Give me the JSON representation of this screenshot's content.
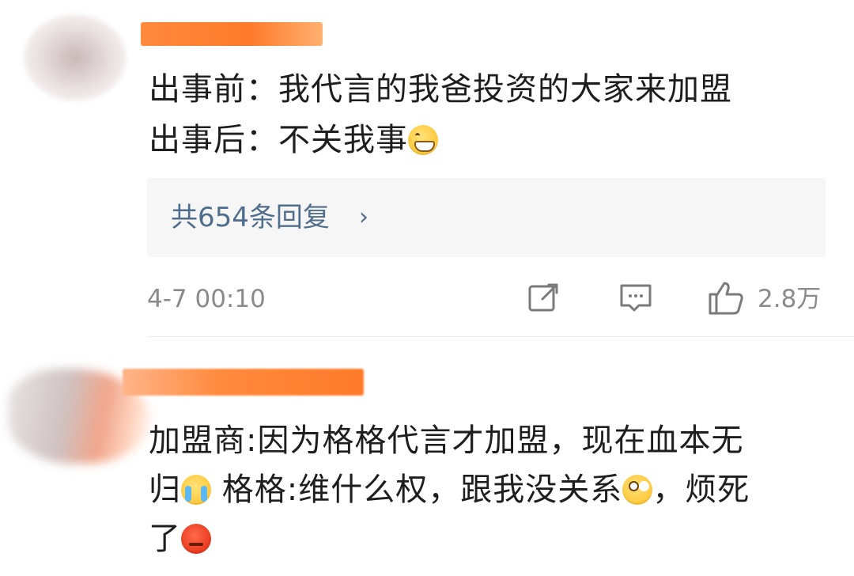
{
  "comments": [
    {
      "lines": [
        "出事前：我代言的我爸投资的大家来加盟",
        "出事后：不关我事"
      ],
      "emojis": [
        "grin"
      ],
      "replies_label": "共654条回复",
      "replies_chevron": "›",
      "timestamp": "4-7 00:10",
      "like_count": "2.8万"
    },
    {
      "lines": [
        "加盟商:因为格格代言才加盟，现在血本无",
        "归",
        "格格:维什么权，跟我没关系",
        "，烦死",
        "了"
      ],
      "emojis": [
        "cry",
        "eyeroll",
        "angry"
      ]
    }
  ],
  "icons": {
    "share": "share-icon",
    "reply": "comment-icon",
    "like": "thumbs-up-icon"
  },
  "colors": {
    "link": "#4f6d8c",
    "meta": "#8a8a8a",
    "redaction": "#ff7a2a"
  }
}
